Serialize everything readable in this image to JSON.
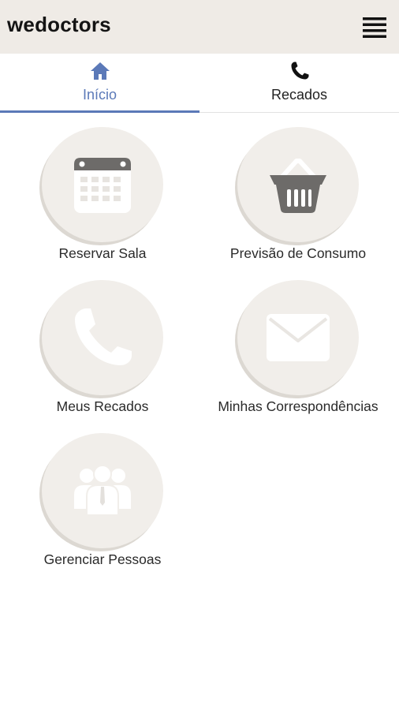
{
  "app": {
    "title": "wedoctors"
  },
  "tabs": [
    {
      "label": "Início",
      "icon": "home-icon",
      "active": true
    },
    {
      "label": "Recados",
      "icon": "phone-icon",
      "active": false
    }
  ],
  "tiles": [
    {
      "label": "Reservar Sala",
      "icon": "calendar-icon"
    },
    {
      "label": "Previsão de Consumo",
      "icon": "basket-icon"
    },
    {
      "label": "Meus Recados",
      "icon": "phone-icon"
    },
    {
      "label": "Minhas Correspondências",
      "icon": "envelope-icon"
    },
    {
      "label": "Gerenciar Pessoas",
      "icon": "people-icon"
    }
  ],
  "colors": {
    "appbar": "#efebe6",
    "accent": "#5b79b8",
    "tile_bg": "#f1eeea",
    "tile_shadow": "#dcd8d2",
    "icon_white": "#ffffff",
    "icon_dark": "#6d6b69"
  }
}
